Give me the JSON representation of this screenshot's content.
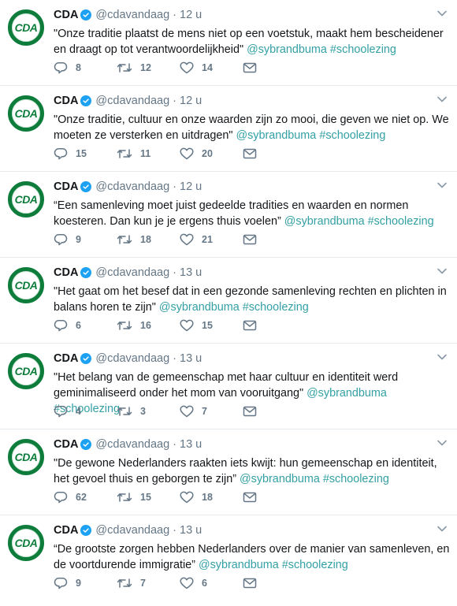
{
  "tweets": [
    {
      "name": "CDA",
      "avatar_text": "CDA",
      "handle": "@cdavandaag",
      "separator": "·",
      "time": "12 u",
      "text": "\"Onze traditie plaatst de mens niet op een voetstuk, maakt hem bescheidener en draagt op tot verantwoordelijkheid\"",
      "mention": "@sybrandbuma",
      "hashtag": "#schoolezing",
      "replies": "8",
      "retweets": "12",
      "likes": "14"
    },
    {
      "name": "CDA",
      "avatar_text": "CDA",
      "handle": "@cdavandaag",
      "separator": "·",
      "time": "12 u",
      "text": "\"Onze traditie, cultuur en onze waarden zijn zo mooi, die geven we niet op. We moeten ze versterken en uitdragen\"",
      "mention": "@sybrandbuma",
      "hashtag": "#schoolezing",
      "replies": "15",
      "retweets": "11",
      "likes": "20"
    },
    {
      "name": "CDA",
      "avatar_text": "CDA",
      "handle": "@cdavandaag",
      "separator": "·",
      "time": "12 u",
      "text": "“Een samenleving moet juist gedeelde tradities en waarden en normen koesteren. Dan kun je je ergens thuis voelen”",
      "mention": "@sybrandbuma",
      "hashtag": "#schoolezing",
      "replies": "9",
      "retweets": "18",
      "likes": "21"
    },
    {
      "name": "CDA",
      "avatar_text": "CDA",
      "handle": "@cdavandaag",
      "separator": "·",
      "time": "13 u",
      "text": "\"Het gaat om het besef dat in een gezonde samenleving rechten en plichten in balans horen te zijn\"",
      "mention": "@sybrandbuma",
      "hashtag": "#schoolezing",
      "replies": "6",
      "retweets": "16",
      "likes": "15"
    },
    {
      "name": "CDA",
      "avatar_text": "CDA",
      "handle": "@cdavandaag",
      "separator": "·",
      "time": "13 u",
      "text": "\"Het belang van de gemeenschap met haar cultuur en identiteit werd geminimaliseerd onder het mom van vooruitgang\"",
      "mention": "@sybrandbuma",
      "hashtag": "#schoolezing",
      "replies": "4",
      "retweets": "3",
      "likes": "7"
    },
    {
      "name": "CDA",
      "avatar_text": "CDA",
      "handle": "@cdavandaag",
      "separator": "·",
      "time": "13 u",
      "text": "\"De gewone Nederlanders raakten iets kwijt: hun gemeenschap en identiteit, het gevoel thuis en geborgen te zijn”",
      "mention": "@sybrandbuma",
      "hashtag": "#schoolezing",
      "replies": "62",
      "retweets": "15",
      "likes": "18"
    },
    {
      "name": "CDA",
      "avatar_text": "CDA",
      "handle": "@cdavandaag",
      "separator": "·",
      "time": "13 u",
      "text": "“De grootste zorgen hebben Nederlanders over de manier van samenleven, en de voortdurende immigratie”",
      "mention": "@sybrandbuma",
      "hashtag": "#schoolezing",
      "replies": "9",
      "retweets": "7",
      "likes": "6"
    }
  ],
  "colors": {
    "brand_green": "#0e7d3c",
    "link": "#34a0a4",
    "verified": "#1da1f2",
    "muted": "#657786"
  },
  "icons": {
    "reply": "reply-icon",
    "retweet": "retweet-icon",
    "like": "heart-icon",
    "dm": "envelope-icon",
    "verified": "verified-badge-icon",
    "caret": "chevron-down-icon"
  }
}
